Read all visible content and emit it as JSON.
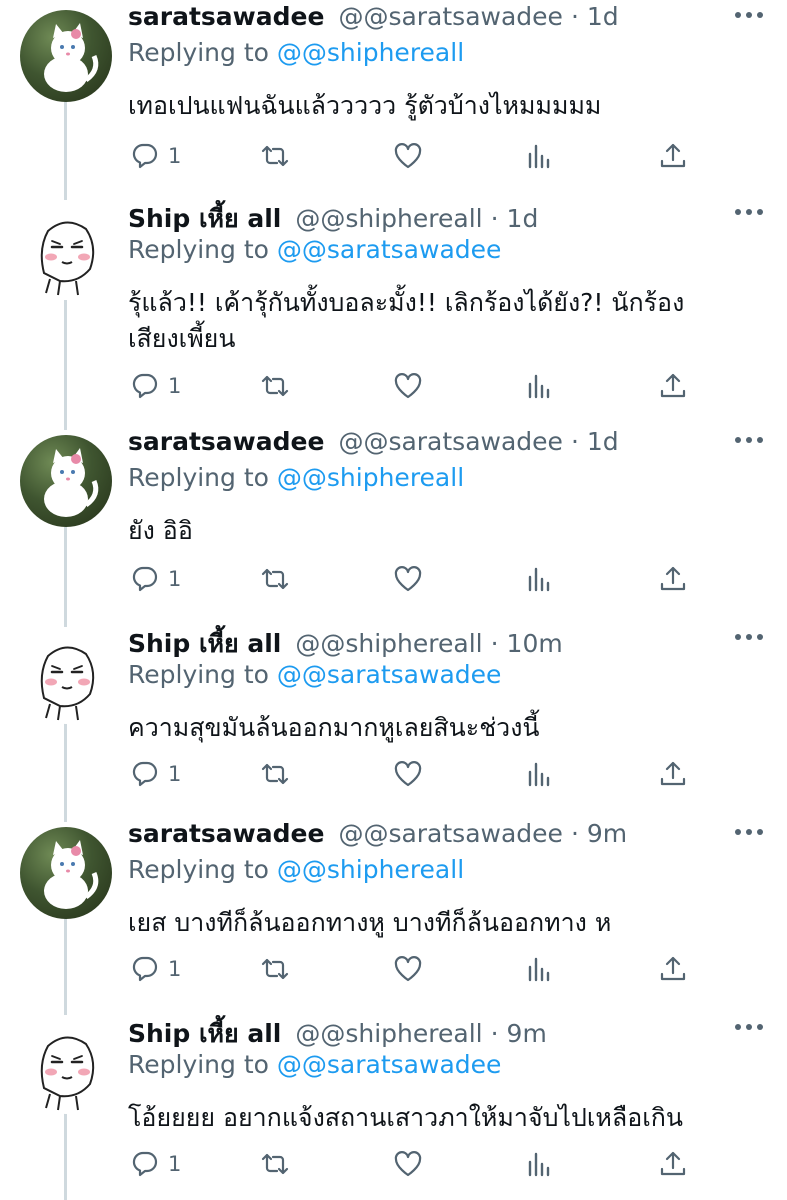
{
  "tweets": [
    {
      "name": "saratsawadee",
      "handle": "@@saratsawadee",
      "time": "1d",
      "replying_label": "Replying to",
      "replying_to": "@@shiphereall",
      "text": "เทอเปนแฟนฉันแล้ววววว รู้ตัวบ้างไหมมมมม",
      "reply_count": "1",
      "avatar": "cat-avatar"
    },
    {
      "name": "Ship เหี้ย all",
      "handle": "@@shiphereall",
      "time": "1d",
      "replying_label": "Replying to",
      "replying_to": "@@saratsawadee",
      "text": "รุ้แล้ว!! เค้ารุ้กันทั้งบอละมั้ง!! เลิกร้องได้ยัง?! นักร้องเสียงเพี้ยน",
      "reply_count": "1",
      "avatar": "face-avatar"
    },
    {
      "name": "saratsawadee",
      "handle": "@@saratsawadee",
      "time": "1d",
      "replying_label": "Replying to",
      "replying_to": "@@shiphereall",
      "text": "ยัง อิอิ",
      "reply_count": "1",
      "avatar": "cat-avatar"
    },
    {
      "name": "Ship เหี้ย all",
      "handle": "@@shiphereall",
      "time": "10m",
      "replying_label": "Replying to",
      "replying_to": "@@saratsawadee",
      "text": "ความสุขมันล้นออกมากหูเลยสินะช่วงนี้",
      "reply_count": "1",
      "avatar": "face-avatar"
    },
    {
      "name": "saratsawadee",
      "handle": "@@saratsawadee",
      "time": "9m",
      "replying_label": "Replying to",
      "replying_to": "@@shiphereall",
      "text": "เยส บางทีก็ล้นออกทางหู บางทีก็ล้นออกทาง ห",
      "reply_count": "1",
      "avatar": "cat-avatar"
    },
    {
      "name": "Ship เหี้ย all",
      "handle": "@@shiphereall",
      "time": "9m",
      "replying_label": "Replying to",
      "replying_to": "@@saratsawadee",
      "text": "โอ้ยยยย อยากแจ้งสถานเสาวภาให้มาจับไปเหลือเกิน",
      "reply_count": "1",
      "avatar": "face-avatar"
    }
  ],
  "icons": {
    "reply": "reply-icon",
    "retweet": "retweet-icon",
    "like": "heart-icon",
    "analytics": "analytics-icon",
    "share": "share-icon",
    "more": "more-icon"
  },
  "colors": {
    "link": "#1d9bf0",
    "secondary": "#536471",
    "primary_text": "#0f1419",
    "thread_line": "#cfd9de"
  }
}
